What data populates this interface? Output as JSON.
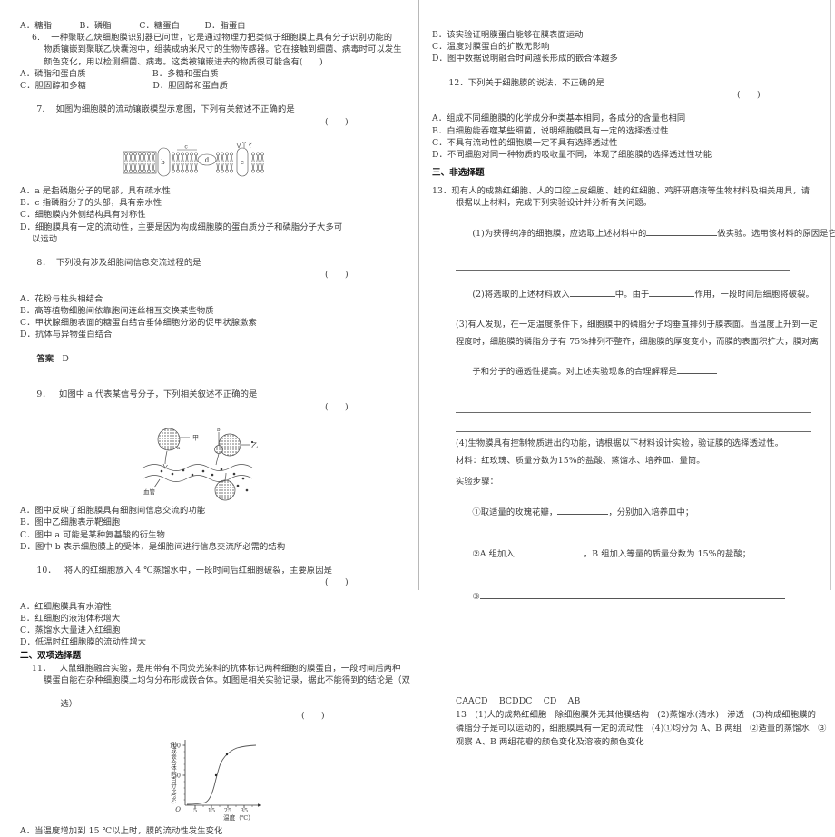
{
  "left_column": {
    "q5_options": "A．糖脂          B．磷脂          C．糖蛋白         D．脂蛋白",
    "q6": {
      "stem_lines": [
        "6.    一种聚联乙炔细胞膜识别器已问世，它是通过物理力把类似于细胞膜上具有分子识别功能的",
        "物质镶嵌到聚联乙炔囊泡中，组装成纳米尺寸的生物传感器。它在接触到细菌、病毒时可以发生",
        "颜色变化，用以检测细菌、病毒。这类被镶嵌进去的物质很可能含有(      )"
      ],
      "options": [
        "A．磷脂和蛋白质                        B．多糖和蛋白质",
        "C．胆固醇和多糖                        D．胆固醇和蛋白质"
      ]
    },
    "q7": {
      "stem": "7.    如图为细胞膜的流动镶嵌模型示意图，下列有关叙述不正确的是",
      "stem_mark": "(      )",
      "figure_labels": [
        "a",
        "b",
        "c",
        "d",
        "e"
      ],
      "options": [
        "A．a 是指磷脂分子的尾部，具有疏水性",
        "B．c 指磷脂分子的头部，具有亲水性",
        "C．细胞膜内外侧结构具有对称性",
        "D．细胞膜具有一定的流动性，主要是因为构成细胞膜的蛋白质分子和磷脂分子大多可",
        "以运动"
      ]
    },
    "q8": {
      "stem": "8．  下列没有涉及细胞间信息交流过程的是",
      "stem_mark": "(      )",
      "options": [
        "A．花粉与柱头相结合",
        "B．高等植物细胞间依靠胞间连丝相互交换某些物质",
        "C．甲状腺细胞表面的糖蛋白结合垂体细胞分泌的促甲状腺激素",
        "D．抗体与异物蛋白结合"
      ],
      "answer_label": "答案",
      "answer_value": "D"
    },
    "q9": {
      "stem": "9．   如图中 a 代表某信号分子，下列相关叙述不正确的是",
      "stem_mark": "(      )",
      "figure_labels": [
        "甲",
        "乙",
        "a",
        "b",
        "血管"
      ],
      "options": [
        "A．图中反映了细胞膜具有细胞间信息交流的功能",
        "B．图中乙细胞表示靶细胞",
        "C．图中 a 可能是某种氨基酸的衍生物",
        "D．图中 b 表示细胞膜上的受体，是细胞间进行信息交流所必需的结构"
      ]
    },
    "q10": {
      "stem": "10．   将人的红细胞放入 4 ℃蒸馏水中，一段时间后红细胞破裂，主要原因是",
      "stem_mark": "(      )",
      "options": [
        "A．红细胞膜具有水溶性",
        "B．红细胞的液泡体积增大",
        "C．蒸馏水大量进入红细胞",
        "D．低温时红细胞膜的流动性增大"
      ]
    },
    "section2_head": "二、双项选择题",
    "q11": {
      "stem_lines": [
        "11．   人鼠细胞融合实验，是用带有不同荧光染料的抗体标记两种细胞的膜蛋白，一段时间后两种",
        "膜蛋白能在杂种细胞膜上均匀分布形成嵌合体。如图是相关实验记录，据此不能得到的结论是（双",
        "选）"
      ],
      "stem_mark": "(      )",
      "optionA": "A．当温度增加到 15 ℃以上时，膜的流动性发生变化"
    }
  },
  "right_column": {
    "q11_options_cont": [
      "B．该实验证明膜蛋白能够在膜表面运动",
      "C．温度对膜蛋白的扩散无影响",
      "D．图中数据说明融合时间越长形成的嵌合体越多"
    ],
    "q12": {
      "stem": "12．下列关于细胞膜的说法，不正确的是",
      "stem_mark": "(      )",
      "options": [
        "A．组成不同细胞膜的化学成分种类基本相同，各成分的含量也相同",
        "B．白细胞能吞噬某些细菌，说明细胞膜具有一定的选择透过性",
        "C．不具有流动性的细胞膜一定不具有选择透过性",
        "D．不同细胞对同一种物质的吸收量不同，体现了细胞膜的选择透过性功能"
      ]
    },
    "section3_head": "三、非选择题",
    "q13": {
      "stem_lines": [
        "13．现有人的成熟红细胞、人的口腔上皮细胞、蛙的红细胞、鸡肝研磨液等生物材料及相关用具，请",
        "根据以上材料，完成下列实验设计并分析有关问题。"
      ],
      "sub1_a": "(1)为获得纯净的细胞膜，应选取上述材料中的",
      "sub1_b": "做实验。选用该材料的原因是它",
      "sub2_a": "(2)将选取的上述材料放入",
      "sub2_b": "中。由于",
      "sub2_c": "作用，一段时间后细胞将破裂。",
      "sub3_lines": [
        "(3)有人发现，在一定温度条件下，细胞膜中的磷脂分子均垂直排列于膜表面。当温度上升到一定",
        "程度时，细胞膜的磷脂分子有 75%排列不整齐，细胞膜的厚度变小，而膜的表面积扩大，膜对离",
        "子和分子的通透性提高。对上述实验现象的合理解释是"
      ],
      "sub4": "(4)生物膜具有控制物质进出的功能，请根据以下材料设计实验，验证膜的选择透过性。",
      "materials": "材料：红玫瑰、质量分数为15%的盐酸、蒸馏水、培养皿、量筒。",
      "steps_head": "实验步骤：",
      "step1_a": "①取适量的玫瑰花瓣，",
      "step1_b": "，分别加入培养皿中；",
      "step2_a": "②A 组加入",
      "step2_b": "，B 组加入等量的质量分数为 15%的盐酸；",
      "step3": "③"
    },
    "answers": {
      "mc_answers": "CAACD    BCDDC    CD    AB",
      "q13_lines": [
        "13   (1)人的成熟红细胞   除细胞膜外无其他膜结构   (2)蒸馏水(清水)   渗透   (3)构成细胞膜的",
        "磷脂分子是可以运动的，细胞膜具有一定的流动性   (4)①均分为 A、B 两组   ②适量的蒸馏水   ③",
        "观察 A、B 两组花瓣的颜色变化及溶液的颜色变化"
      ]
    }
  },
  "chart_data": {
    "type": "line",
    "title": "",
    "xlabel": "温度（℃）",
    "ylabel": "形成嵌合体的百分比(%)",
    "x": [
      0,
      5,
      10,
      13,
      15,
      17,
      19,
      21,
      24,
      27,
      30,
      35,
      38
    ],
    "values": [
      1,
      1,
      2,
      3,
      6,
      20,
      50,
      68,
      85,
      93,
      97,
      99,
      100
    ],
    "data_points": [
      {
        "x": 19,
        "y": 50
      },
      {
        "x": 24,
        "y": 85
      }
    ],
    "xticks": [
      5,
      15,
      25,
      35
    ],
    "yticks": [
      50,
      100
    ],
    "ylim": [
      0,
      108
    ],
    "xlim": [
      0,
      40
    ],
    "origin_label": "O",
    "grid": false,
    "legend": ""
  }
}
